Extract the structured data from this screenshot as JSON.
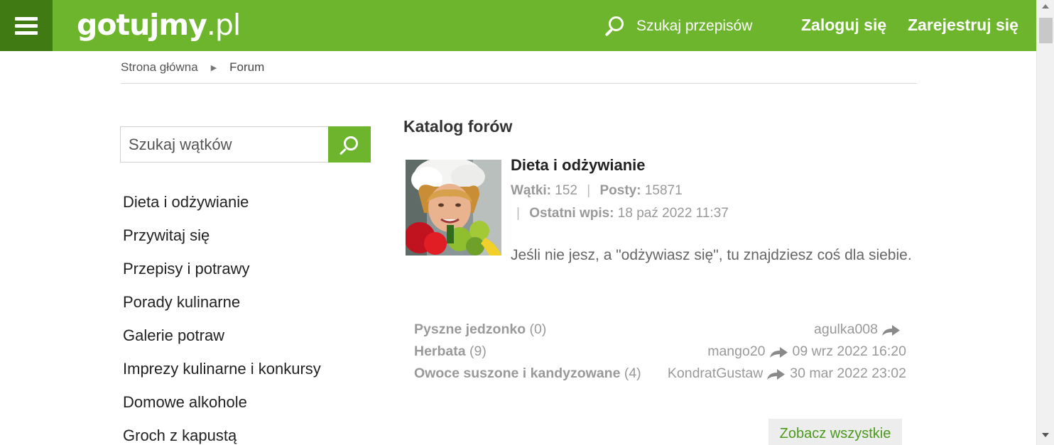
{
  "header": {
    "logo_text": "gotujmy",
    "logo_suffix": ".pl",
    "search_placeholder": "Szukaj przepisów",
    "login_label": "Zaloguj się",
    "register_label": "Zarejestruj się",
    "brand_color": "#6cb52d"
  },
  "breadcrumb": {
    "home": "Strona główna",
    "separator": "▶",
    "current": "Forum"
  },
  "sidebar": {
    "search_placeholder": "Szukaj wątków",
    "categories": [
      "Dieta i odżywianie",
      "Przywitaj się",
      "Przepisy i potrawy",
      "Porady kulinarne",
      "Galerie potraw",
      "Imprezy kulinarne i konkursy",
      "Domowe alkohole",
      "Groch z kapustą"
    ]
  },
  "main": {
    "title": "Katalog forów",
    "forum": {
      "name": "Dieta i odżywianie",
      "threads_label": "Wątki:",
      "threads_value": "152",
      "posts_label": "Posty:",
      "posts_value": "15871",
      "last_post_label": "Ostatni wpis:",
      "last_post_value": "18 paź 2022 11:37",
      "description": "Jeśli nie jesz, a \"odżywiasz się\", tu znajdziesz coś dla siebie."
    },
    "threads": [
      {
        "title": "Pyszne jedzonko",
        "count": "(0)",
        "author": "agulka008",
        "date": ""
      },
      {
        "title": "Herbata",
        "count": "(9)",
        "author": "mango20",
        "date": "09 wrz 2022 16:20"
      },
      {
        "title": "Owoce suszone i kandyzowane",
        "count": "(4)",
        "author": "KondratGustaw",
        "date": "30 mar 2022 23:02"
      }
    ],
    "see_all_label": "Zobacz wszystkie"
  }
}
